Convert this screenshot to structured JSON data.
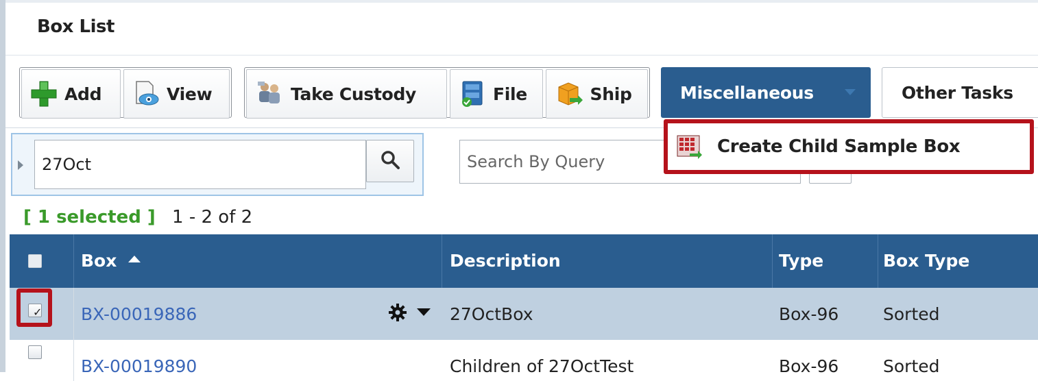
{
  "panel": {
    "title": "Box List"
  },
  "toolbar": {
    "add_label": "Add",
    "view_label": "View",
    "take_custody_label": "Take Custody",
    "file_label": "File",
    "ship_label": "Ship",
    "misc_label": "Miscellaneous",
    "other_tasks_label": "Other Tasks"
  },
  "dropdown": {
    "create_child_label": "Create Child Sample Box"
  },
  "search": {
    "value": "27Oct",
    "query_placeholder": "Search By Query"
  },
  "selection": {
    "selected_text": "[ 1 selected ]",
    "range_text": "1 - 2 of 2"
  },
  "table": {
    "columns": [
      "Box",
      "Description",
      "Type",
      "Box Type"
    ],
    "rows": [
      {
        "box": "BX-00019886",
        "description": "27OctBox",
        "type": "Box-96",
        "box_type": "Sorted",
        "checked": true
      },
      {
        "box": "BX-00019890",
        "description": "Children of 27OctTest",
        "type": "Box-96",
        "box_type": "Sorted",
        "checked": false
      }
    ]
  },
  "icons": {
    "add": "plus-icon",
    "view": "view-document-icon",
    "take_custody": "custody-people-icon",
    "file": "file-cabinet-icon",
    "ship": "ship-box-icon",
    "create_child": "grid-box-icon",
    "search": "search-icon",
    "row_settings": "gear-icon",
    "sort": "sort-asc-icon"
  },
  "colors": {
    "header_blue": "#2a5d8f",
    "highlight_red": "#b5121b",
    "selected_row": "#bfd0e0",
    "selected_green": "#3a9a2a",
    "link_blue": "#3a66b8"
  }
}
